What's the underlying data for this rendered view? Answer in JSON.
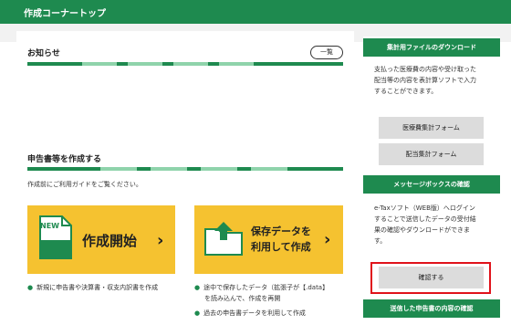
{
  "header": {
    "title": "作成コーナートップ"
  },
  "notice": {
    "title": "お知らせ",
    "list_button": "一覧"
  },
  "create": {
    "title": "申告書等を作成する",
    "description": "作成前にご利用ガイドをご覧ください。",
    "start_button": {
      "badge": "NEW",
      "label": "作成開始"
    },
    "resume_button": {
      "label_line1": "保存データを",
      "label_line2": "利用して作成"
    },
    "start_notes": [
      "新規に申告書や決算書・収支内訳書を作成"
    ],
    "resume_notes": [
      "途中で保存したデータ（拡張子が【.data】",
      "を読み込んで、作成を再開",
      "過去の申告書データを利用して作成"
    ]
  },
  "sidebar": {
    "download": {
      "heading": "集計用ファイルのダウンロード",
      "text": [
        "支払った医療費の内容や受け取った",
        "配当等の内容を表計算ソフトで入力",
        "することができます。"
      ],
      "buttons": [
        "医療費集計フォーム",
        "配当集計フォーム"
      ]
    },
    "messagebox": {
      "heading": "メッセージボックスの確認",
      "text": [
        "e-Taxソフト（WEB版）へログイン",
        "することで送信したデータの受付結",
        "果の確認やダウンロードができま",
        "す。"
      ],
      "confirm_button": "確認する"
    },
    "sent": {
      "heading": "送信した申告書の内容の確認"
    }
  },
  "colors": {
    "brand_green": "#1e8a4f",
    "accent_yellow": "#f5c230",
    "highlight_red": "#e0121b"
  }
}
